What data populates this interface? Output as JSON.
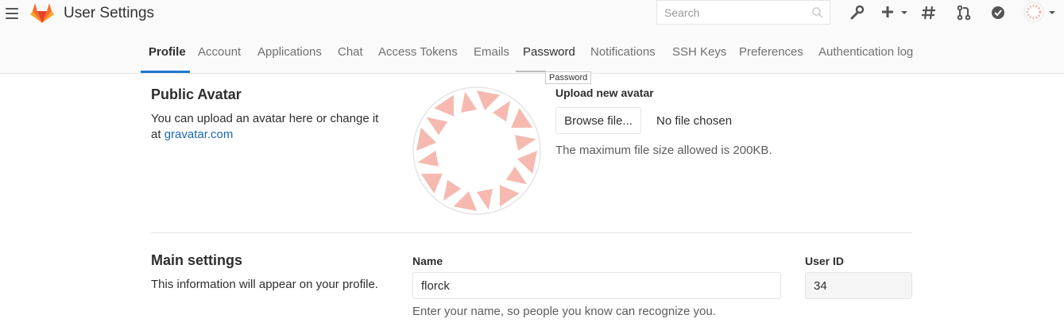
{
  "header": {
    "title": "User Settings",
    "search_placeholder": "Search",
    "icons": [
      "menu-icon",
      "gitlab-logo",
      "wrench-icon",
      "plus-icon",
      "hash-icon",
      "merge-request-icon",
      "check-circle-icon",
      "user-avatar"
    ]
  },
  "tabs": [
    {
      "label": "Profile",
      "active": true
    },
    {
      "label": "Account"
    },
    {
      "label": "Applications"
    },
    {
      "label": "Chat"
    },
    {
      "label": "Access Tokens"
    },
    {
      "label": "Emails"
    },
    {
      "label": "Password"
    },
    {
      "label": "Notifications"
    },
    {
      "label": "SSH Keys"
    },
    {
      "label": "Preferences"
    },
    {
      "label": "Authentication log"
    }
  ],
  "tooltip": "Password",
  "avatar_section": {
    "title": "Public Avatar",
    "desc_prefix": "You can upload an avatar here or change it at",
    "link_text": "gravatar.com",
    "upload_label": "Upload new avatar",
    "browse_button": "Browse file...",
    "no_file": "No file chosen",
    "help": "The maximum file size allowed is 200KB."
  },
  "main_settings": {
    "title": "Main settings",
    "desc": "This information will appear on your profile.",
    "name_label": "Name",
    "name_value": "florck",
    "name_help": "Enter your name, so people you know can recognize you.",
    "userid_label": "User ID",
    "userid_value": "34"
  },
  "colors": {
    "accent": "#1f78d1",
    "avatar_pattern": "#f6b9b0",
    "logo_orange": "#e24329"
  }
}
